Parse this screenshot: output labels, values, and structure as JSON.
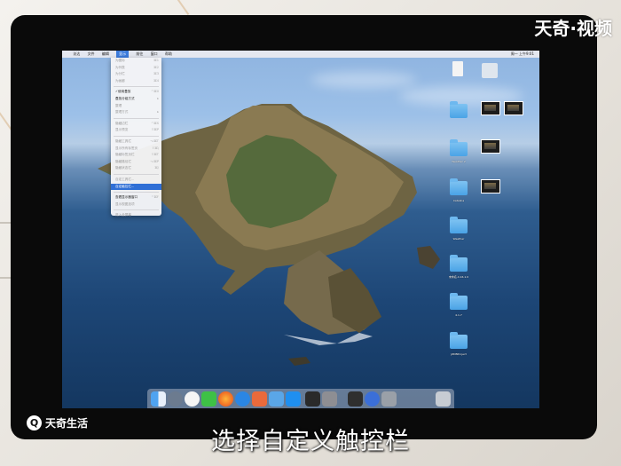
{
  "watermark": "天奇·视频",
  "badge": {
    "icon": "q-logo-icon",
    "text": "天奇生活"
  },
  "caption": "选择自定义触控栏",
  "menubar": {
    "items": [
      "访达",
      "文件",
      "编辑",
      "显示",
      "前往",
      "窗口",
      "帮助"
    ],
    "active_index": 3,
    "right": "周一 上午9:01"
  },
  "menu": {
    "items": [
      {
        "label": "为图标",
        "shortcut": "⌘1",
        "enabled": false
      },
      {
        "label": "为列表",
        "shortcut": "⌘2",
        "enabled": false
      },
      {
        "label": "为分栏",
        "shortcut": "⌘3",
        "enabled": false
      },
      {
        "label": "为画廊",
        "shortcut": "⌘4",
        "enabled": false
      },
      {
        "sep": true
      },
      {
        "label": "✓使用叠放",
        "shortcut": "^⌘0",
        "enabled": true
      },
      {
        "label": "叠放分组方式",
        "shortcut": "▸",
        "enabled": true
      },
      {
        "label": "整理",
        "shortcut": "",
        "enabled": false
      },
      {
        "label": "整理方式",
        "shortcut": "▸",
        "enabled": false
      },
      {
        "sep": true
      },
      {
        "label": "隐藏边栏",
        "shortcut": "^⌘S",
        "enabled": false
      },
      {
        "label": "显示预览",
        "shortcut": "⇧⌘P",
        "enabled": false
      },
      {
        "sep": true
      },
      {
        "label": "隐藏工具栏",
        "shortcut": "⌥⌘T",
        "enabled": false
      },
      {
        "label": "显示所有标签页",
        "shortcut": "⇧⌘\\",
        "enabled": false
      },
      {
        "label": "隐藏标签页栏",
        "shortcut": "⇧⌘T",
        "enabled": false
      },
      {
        "label": "隐藏路径栏",
        "shortcut": "⌥⌘P",
        "enabled": false
      },
      {
        "label": "隐藏状态栏",
        "shortcut": "⌘/",
        "enabled": false
      },
      {
        "sep": true
      },
      {
        "label": "自定工具栏...",
        "shortcut": "",
        "enabled": false
      },
      {
        "label": "自定触控栏...",
        "shortcut": "",
        "enabled": true,
        "highlighted": true
      },
      {
        "sep": true
      },
      {
        "label": "查看显示器窗口",
        "shortcut": "^⌘F",
        "enabled": true
      },
      {
        "label": "显示视图选项",
        "shortcut": "",
        "enabled": false
      },
      {
        "sep": true
      },
      {
        "label": "进入全屏幕",
        "shortcut": "",
        "enabled": false
      }
    ]
  },
  "desktop": {
    "labels": [
      "Weather 2",
      "Catalina",
      "Weather",
      "未命名.4.16.1.0",
      "4.1.7",
      "JZDBProject"
    ]
  },
  "colors": {
    "accent": "#2f6fd6",
    "folder": "#5ab0ec"
  }
}
